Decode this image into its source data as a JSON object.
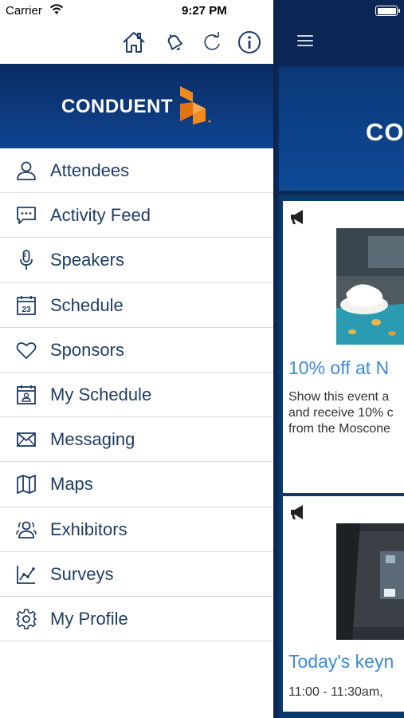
{
  "status_bar": {
    "carrier": "Carrier",
    "time": "9:27 PM"
  },
  "toolbar": {
    "icons": [
      "home-icon",
      "bell-icon",
      "refresh-icon",
      "info-icon"
    ]
  },
  "brand": {
    "wordmark": "CONDUENT",
    "color": "#f08a1c"
  },
  "menu": {
    "items": [
      {
        "label": "Attendees",
        "icon": "person-icon"
      },
      {
        "label": "Activity Feed",
        "icon": "chat-bubble-icon"
      },
      {
        "label": "Speakers",
        "icon": "microphone-icon"
      },
      {
        "label": "Schedule",
        "icon": "calendar-23-icon"
      },
      {
        "label": "Sponsors",
        "icon": "heart-icon"
      },
      {
        "label": "My Schedule",
        "icon": "calendar-person-icon"
      },
      {
        "label": "Messaging",
        "icon": "envelope-icon"
      },
      {
        "label": "Maps",
        "icon": "map-icon"
      },
      {
        "label": "Exhibitors",
        "icon": "people-icon"
      },
      {
        "label": "Surveys",
        "icon": "chart-icon"
      },
      {
        "label": "My Profile",
        "icon": "gear-icon"
      }
    ]
  },
  "main": {
    "banner_text": "CO",
    "cards": [
      {
        "title": "10% off at N",
        "body": [
          "Show this event a",
          "and receive 10% c",
          "from the Moscone"
        ]
      },
      {
        "title": "Today's keyn",
        "body": [
          "11:00 - 11:30am,"
        ]
      }
    ]
  }
}
